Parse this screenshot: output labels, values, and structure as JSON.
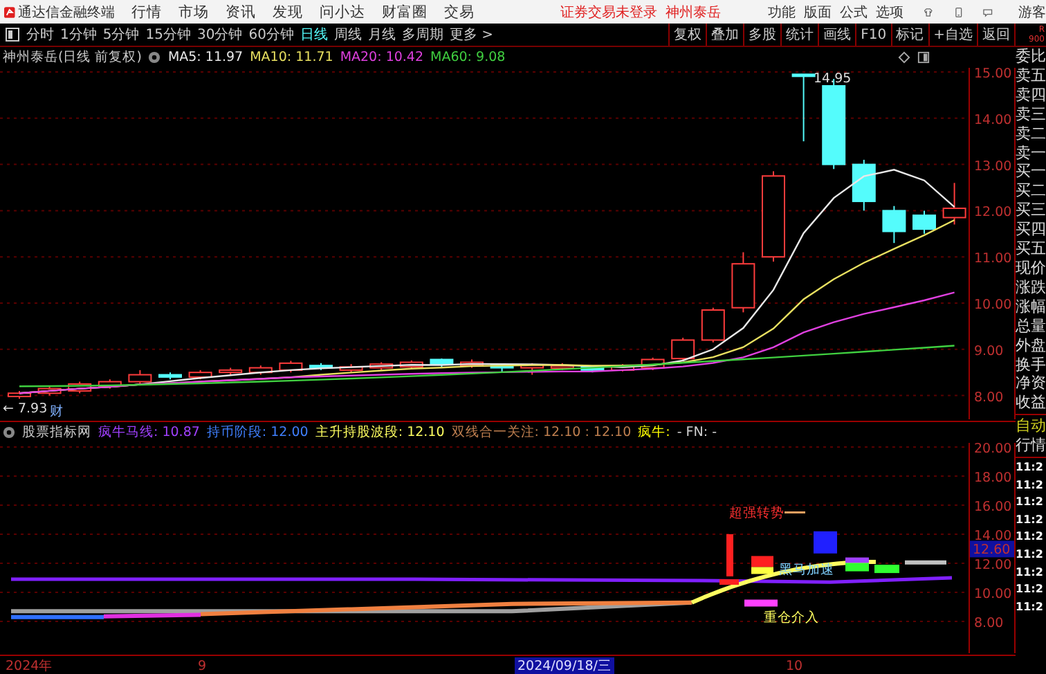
{
  "title_bar": {
    "app_name": "通达信金融终端",
    "menus": [
      "行情",
      "市场",
      "资讯",
      "发现",
      "问小达",
      "财富圈",
      "交易"
    ],
    "login_status": "证券交易未登录",
    "stock_name": "神州泰岳",
    "right_menus": [
      "功能",
      "版面",
      "公式",
      "选项"
    ],
    "user": "游客"
  },
  "toolbar": {
    "periods": [
      {
        "label": "分时",
        "selected": false
      },
      {
        "label": "1分钟",
        "selected": false
      },
      {
        "label": "5分钟",
        "selected": false
      },
      {
        "label": "15分钟",
        "selected": false
      },
      {
        "label": "30分钟",
        "selected": false
      },
      {
        "label": "60分钟",
        "selected": false
      },
      {
        "label": "日线",
        "selected": true
      },
      {
        "label": "周线",
        "selected": false
      },
      {
        "label": "月线",
        "selected": false
      },
      {
        "label": "多周期",
        "selected": false
      },
      {
        "label": "更多 >",
        "selected": false
      }
    ],
    "tools": [
      "复权",
      "叠加",
      "多股",
      "统计",
      "画线",
      "F10",
      "标记",
      "+自选",
      "返回"
    ],
    "corner": [
      "R",
      "900"
    ]
  },
  "price_chart": {
    "title": "神州泰岳(日线 前复权)",
    "legend": [
      {
        "text": "MA5: 11.97",
        "color": "#e8e8e8"
      },
      {
        "text": "MA10: 11.71",
        "color": "#e8e060"
      },
      {
        "text": "MA20: 10.42",
        "color": "#e040e0"
      },
      {
        "text": "MA60: 9.08",
        "color": "#40d040"
      }
    ],
    "high_label": "14.95",
    "low_label": "← 7.93",
    "marker": "财",
    "y_labels": [
      "15.00",
      "14.00",
      "13.00",
      "12.00",
      "11.00",
      "10.00",
      "9.00",
      "8.00"
    ]
  },
  "indicator": {
    "title": "股票指标网",
    "legend": [
      {
        "text": "疯牛马线: 10.87",
        "color": "#a040ff"
      },
      {
        "text": "持币阶段: 12.00",
        "color": "#4080ff"
      },
      {
        "text": "主升持股波段: 12.10",
        "color": "#ffff60"
      },
      {
        "text": "双线合一关注: 12.10 : 12.10",
        "color": "#c08050"
      },
      {
        "text": "疯牛:",
        "color": "#ffff00"
      },
      {
        "text": "- FN: -",
        "color": "#d0d0d0"
      }
    ],
    "annotations": [
      "超强转势",
      "黑马加速",
      "重仓介入"
    ],
    "y_labels": [
      "20.00",
      "18.00",
      "16.00",
      "14.00",
      "12.00",
      "10.00",
      "8.00"
    ],
    "current_value": "12.60"
  },
  "time_axis": [
    {
      "label": "2024年",
      "highlighted": false
    },
    {
      "label": "9",
      "highlighted": false
    },
    {
      "label": "2024/09/18/三",
      "highlighted": true
    },
    {
      "label": "10",
      "highlighted": false
    }
  ],
  "side_panel": {
    "quote_labels": [
      "委比",
      "卖五",
      "卖四",
      "卖三",
      "卖二",
      "卖一",
      "买一",
      "买二",
      "买三",
      "买四",
      "买五",
      "现价",
      "涨跌",
      "涨幅",
      "总量",
      "外盘",
      "换手",
      "净资",
      "收益"
    ],
    "mode_labels": [
      "自动",
      "行情"
    ],
    "times": [
      "11:2",
      "11:2",
      "11:2",
      "11:2",
      "11:2",
      "11:2",
      "11:2",
      "11:2",
      "11:2"
    ]
  }
}
